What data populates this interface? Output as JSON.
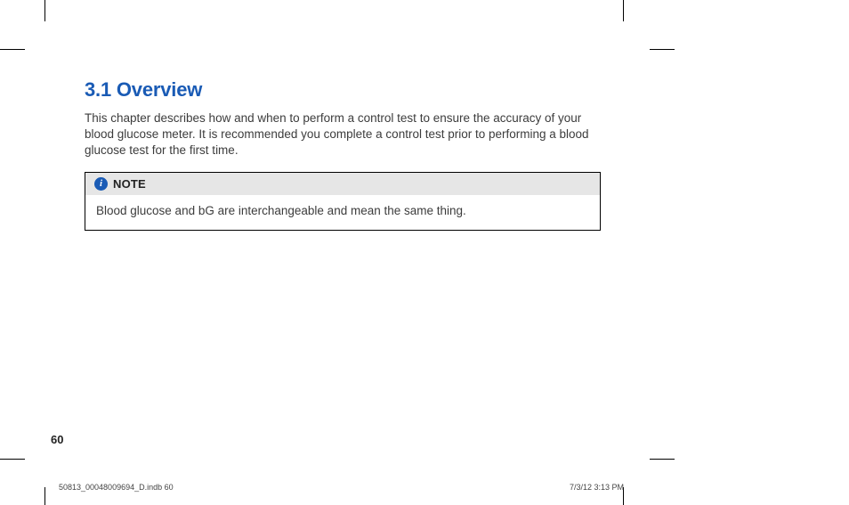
{
  "heading": "3.1 Overview",
  "body": "This chapter describes how and when to perform a control test to ensure the accuracy of your blood glucose meter. It is recommended you complete a control test prior to performing a blood glucose test for the first time.",
  "note": {
    "icon_glyph": "i",
    "label": "NOTE",
    "body": "Blood glucose and bG are interchangeable and mean the same thing."
  },
  "page_number": "60",
  "footer": {
    "left": "50813_00048009694_D.indb   60",
    "right": "7/3/12   3:13 PM"
  }
}
